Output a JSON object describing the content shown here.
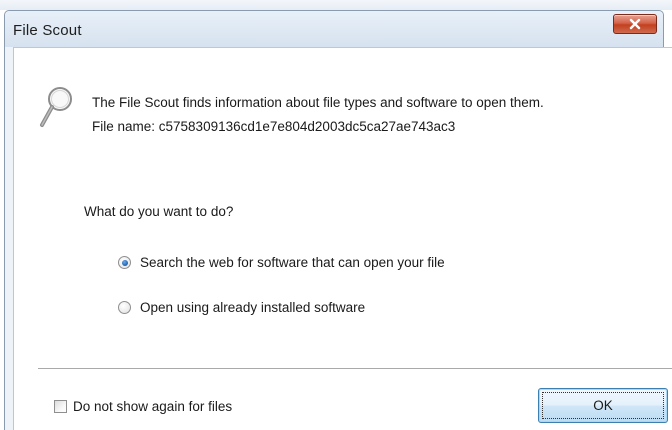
{
  "window": {
    "title": "File Scout",
    "close_icon": "close-icon"
  },
  "info": {
    "icon": "magnifier-icon",
    "description": "The File Scout finds information about file types and software to open them.",
    "file_name_line": "File name: c5758309136cd1e7e804d2003dc5ca27ae743ac3"
  },
  "question": "What do you want to do?",
  "options": [
    {
      "label": "Search the web for software that can open your file",
      "checked": true
    },
    {
      "label": "Open using already installed software",
      "checked": false
    }
  ],
  "footer": {
    "checkbox_label": "Do not show again for  files",
    "checkbox_checked": false,
    "ok_label": "OK"
  },
  "colors": {
    "close_button": "#d4624a",
    "radio_selected": "#1c5fb0",
    "ok_border": "#3c7fb1"
  }
}
